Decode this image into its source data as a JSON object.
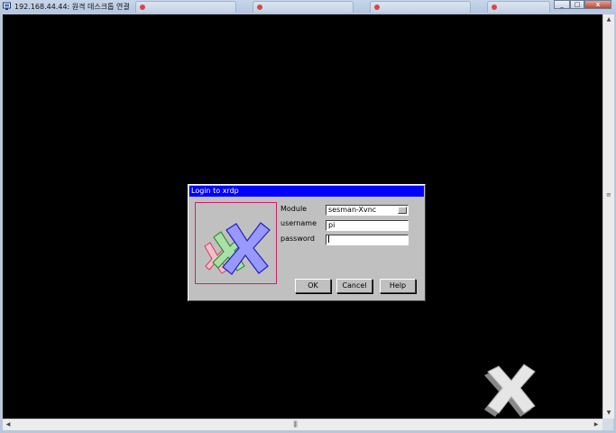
{
  "window": {
    "title": "192.168.44.44: 원격 데스크톱 연결",
    "background_tabs": [
      "",
      "",
      "",
      ""
    ],
    "controls": {
      "minimize": "_",
      "maximize": "□",
      "close": "x"
    }
  },
  "dialog": {
    "title": "Login to xrdp",
    "fields": {
      "module_label": "Module",
      "module_value": "sesman-Xvnc",
      "username_label": "username",
      "username_value": "pi",
      "password_label": "password",
      "password_value": ""
    },
    "buttons": {
      "ok": "OK",
      "cancel": "Cancel",
      "help": "Help"
    }
  },
  "colors": {
    "dialog_title_bg": "#0000ff",
    "dialog_bg": "#c0c0c0",
    "desktop_bg": "#000000"
  }
}
